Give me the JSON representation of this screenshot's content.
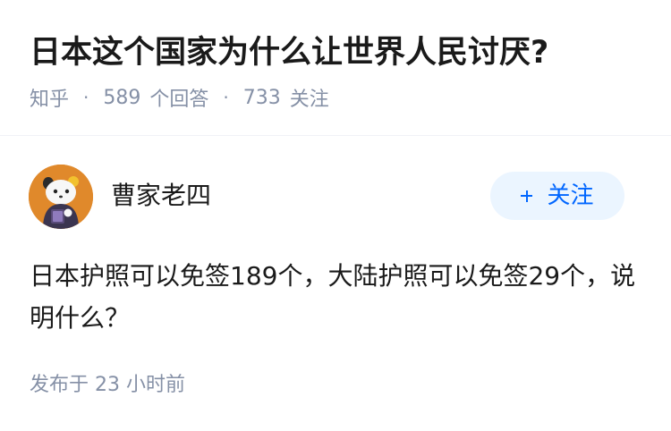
{
  "question": {
    "title": "日本这个国家为什么让世界人民讨厌?",
    "source": "知乎",
    "separator": "·",
    "answer_count": "589",
    "answer_label": "个回答",
    "follower_count": "733",
    "follower_label": "关注"
  },
  "answer": {
    "author": {
      "name": "曹家老四",
      "avatar_icon": "cartoon-avatar-icon"
    },
    "follow_button": {
      "icon": "plus-icon",
      "label": "关注"
    },
    "content": "日本护照可以免签189个，大陆护照可以免签29个，说明什么？",
    "published": "发布于  23 小时前"
  },
  "colors": {
    "accent": "#0066ff",
    "follow_bg": "#ebf5ff",
    "muted_text": "#8590a6",
    "primary_text": "#1a1a1a",
    "avatar_bg": "#e0892b"
  }
}
